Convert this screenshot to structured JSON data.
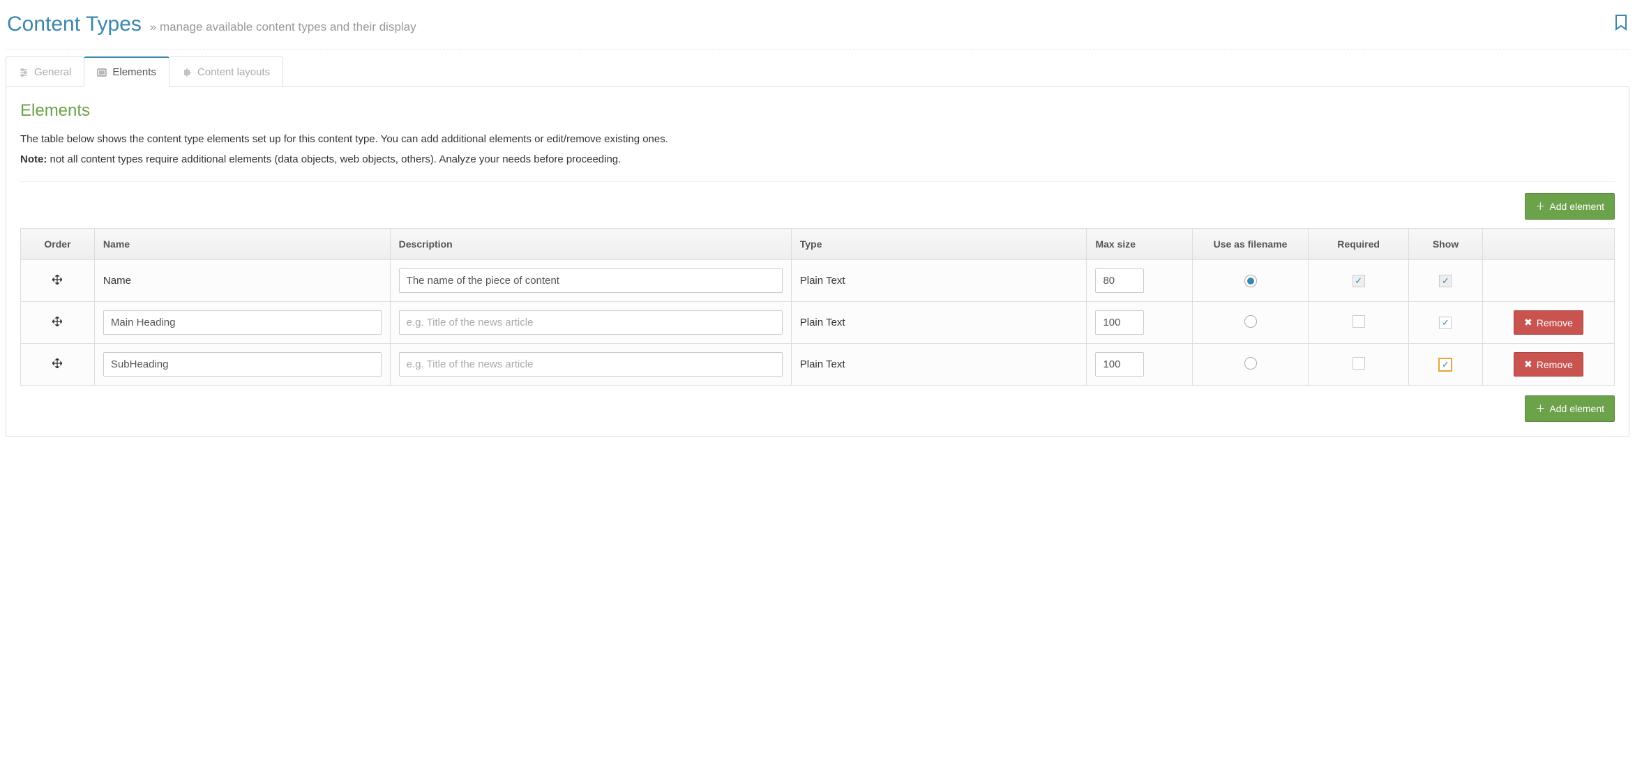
{
  "header": {
    "title": "Content Types",
    "subtitle": "manage available content types and their display"
  },
  "tabs": [
    {
      "label": "General",
      "active": false
    },
    {
      "label": "Elements",
      "active": true
    },
    {
      "label": "Content layouts",
      "active": false
    }
  ],
  "section": {
    "title": "Elements",
    "intro": "The table below shows the content type elements set up for this content type. You can add additional elements or edit/remove existing ones.",
    "note_label": "Note:",
    "note_text": " not all content types require additional elements (data objects, web objects, others). Analyze your needs before proceeding."
  },
  "buttons": {
    "add_element": "Add element",
    "remove": "Remove"
  },
  "table": {
    "headers": {
      "order": "Order",
      "name": "Name",
      "description": "Description",
      "type": "Type",
      "maxsize": "Max size",
      "useas": "Use as filename",
      "required": "Required",
      "show": "Show"
    },
    "rows": [
      {
        "name_static": "Name",
        "name_editable": false,
        "desc_value": "The name of the piece of content",
        "desc_placeholder": "",
        "type": "Plain Text",
        "maxsize": "80",
        "useas_checked": true,
        "required_checked": true,
        "required_disabled": true,
        "show_checked": true,
        "show_disabled": true,
        "show_focus": false,
        "removable": false
      },
      {
        "name_value": "Main Heading",
        "name_editable": true,
        "desc_value": "",
        "desc_placeholder": "e.g. Title of the news article",
        "type": "Plain Text",
        "maxsize": "100",
        "useas_checked": false,
        "required_checked": false,
        "required_disabled": false,
        "show_checked": true,
        "show_disabled": false,
        "show_focus": false,
        "removable": true
      },
      {
        "name_value": "SubHeading",
        "name_editable": true,
        "desc_value": "",
        "desc_placeholder": "e.g. Title of the news article",
        "type": "Plain Text",
        "maxsize": "100",
        "useas_checked": false,
        "required_checked": false,
        "required_disabled": false,
        "show_checked": true,
        "show_disabled": false,
        "show_focus": true,
        "removable": true
      }
    ]
  }
}
